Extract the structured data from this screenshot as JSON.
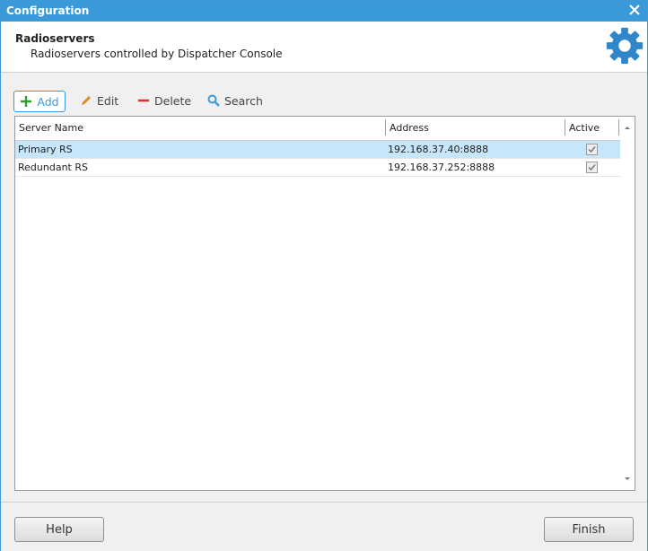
{
  "window": {
    "title": "Configuration"
  },
  "header": {
    "title": "Radioservers",
    "subtitle": "Radioservers controlled by Dispatcher Console"
  },
  "toolbar": {
    "add": "Add",
    "edit": "Edit",
    "delete": "Delete",
    "search": "Search"
  },
  "table": {
    "columns": [
      "Server Name",
      "Address",
      "Active"
    ],
    "rows": [
      {
        "name": "Primary RS",
        "address": "192.168.37.40:8888",
        "active": true,
        "selected": true
      },
      {
        "name": "Redundant RS",
        "address": "192.168.37.252:8888",
        "active": true,
        "selected": false
      }
    ]
  },
  "footer": {
    "help": "Help",
    "finish": "Finish"
  },
  "colors": {
    "accent": "#3a9ad9",
    "selection": "#c6e6fb",
    "add_icon": "#2e9e2e",
    "edit_icon": "#e08a1e",
    "delete_icon": "#d9372c"
  },
  "icons": [
    "close-icon",
    "gear-icon",
    "plus-icon",
    "pencil-icon",
    "minus-icon",
    "magnifier-icon",
    "checkbox-checked-icon",
    "scroll-up-icon",
    "scroll-down-icon"
  ]
}
